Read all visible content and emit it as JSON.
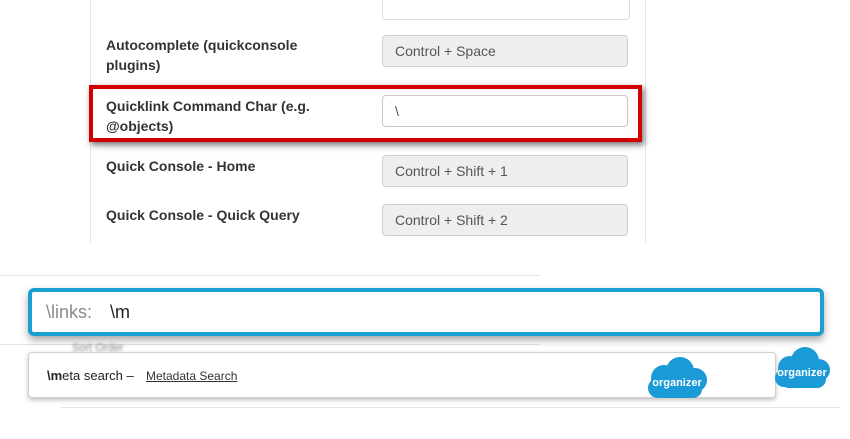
{
  "settings": {
    "rows": [
      {
        "label": "Autocomplete (quickconsole plugins)",
        "value": "Control + Space"
      },
      {
        "label": "Quicklink Command Char (e.g. @objects)",
        "value": "\\"
      },
      {
        "label": "Quick Console - Home",
        "value": "Control + Shift + 1"
      },
      {
        "label": "Quick Console - Quick Query",
        "value": "Control + Shift + 2"
      }
    ],
    "highlight_color": "#d20000"
  },
  "background_page": {
    "fields": [
      "Sort Order"
    ]
  },
  "console": {
    "prefix": "\\links:",
    "input_value": "\\m",
    "accent_color": "#1b9fd0"
  },
  "suggestion": {
    "command_bold": "\\m",
    "command_rest": "eta search –",
    "link_text": "Metadata Search"
  },
  "logos": [
    {
      "icon": "organizer-cloud-logo",
      "text": "organizer",
      "color": "#1a9ad6"
    },
    {
      "icon": "organizer-cloud-logo",
      "text": "organizer",
      "color": "#1a9ad6"
    }
  ]
}
